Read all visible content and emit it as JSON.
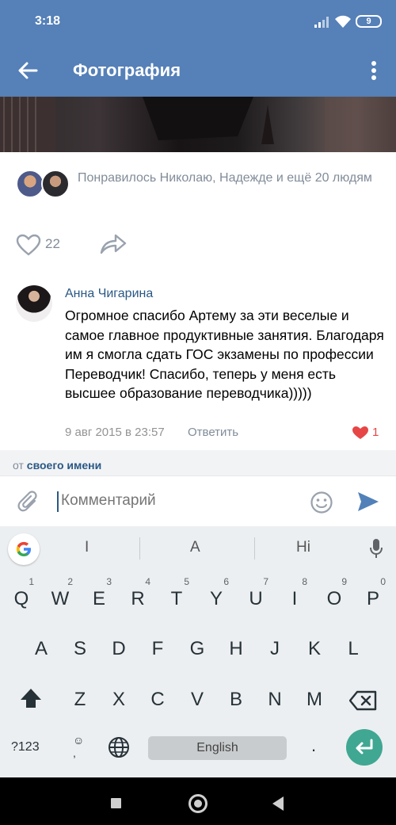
{
  "status_bar": {
    "time": "3:18",
    "battery": "9",
    "icons": [
      "signal-icon",
      "wifi-icon",
      "battery-icon"
    ]
  },
  "app_bar": {
    "title": "Фотография",
    "back_icon": "arrow-left-icon",
    "menu_icon": "more-vertical-icon",
    "color": "#5580b8"
  },
  "likes": {
    "text": "Понравилось Николаю, Надежде и ещё 20 людям"
  },
  "actions": {
    "like_count": "22",
    "like_icon": "heart-outline-icon",
    "share_icon": "share-icon"
  },
  "comment": {
    "author": "Анна Чигарина",
    "text": "Огромное спасибо Артему за эти веселые и самое главное продуктивные занятия. Благодаря им я смогла сдать ГОС экзамены по профессии Переводчик! Спасибо, теперь у меня есть высшее образование переводчика)))))",
    "date": "9 авг 2015 в 23:57",
    "reply_label": "Ответить",
    "like_count": "1",
    "like_color": "#e64646"
  },
  "from": {
    "prefix": "от",
    "link": "своего имени"
  },
  "input": {
    "placeholder": "Комментарий"
  },
  "keyboard": {
    "suggestions": [
      "I",
      "A",
      "Hi"
    ],
    "row1": [
      {
        "key": "Q",
        "hint": "1"
      },
      {
        "key": "W",
        "hint": "2"
      },
      {
        "key": "E",
        "hint": "3"
      },
      {
        "key": "R",
        "hint": "4"
      },
      {
        "key": "T",
        "hint": "5"
      },
      {
        "key": "Y",
        "hint": "6"
      },
      {
        "key": "U",
        "hint": "7"
      },
      {
        "key": "I",
        "hint": "8"
      },
      {
        "key": "O",
        "hint": "9"
      },
      {
        "key": "P",
        "hint": "0"
      }
    ],
    "row2": [
      "A",
      "S",
      "D",
      "F",
      "G",
      "H",
      "J",
      "K",
      "L"
    ],
    "row3": [
      "Z",
      "X",
      "C",
      "V",
      "B",
      "N",
      "M"
    ],
    "sym_label": "?123",
    "space_label": "English",
    "period_label": ".",
    "accent": "#40a792"
  },
  "nav": {
    "icons": [
      "recents-icon",
      "home-icon",
      "back-icon"
    ]
  }
}
